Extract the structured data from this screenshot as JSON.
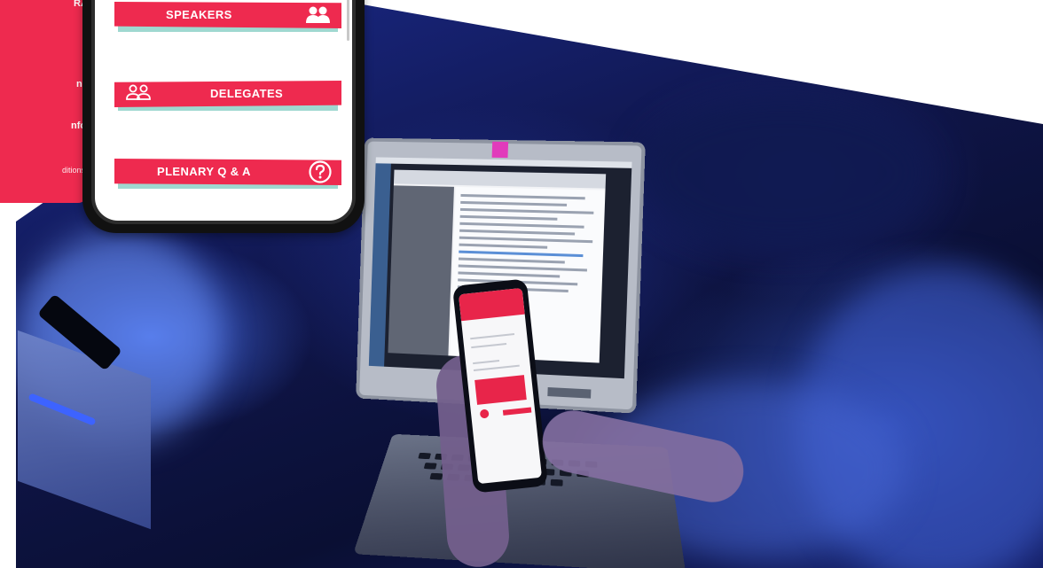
{
  "left_menu": {
    "items": [
      "RA",
      "ns",
      "nfo",
      "ditions"
    ]
  },
  "phone_menu": {
    "items": [
      {
        "label": "SPEAKERS",
        "icon": "speakers-icon"
      },
      {
        "label": "DELEGATES",
        "icon": "delegates-icon"
      },
      {
        "label": "PLENARY Q & A",
        "icon": "question-icon"
      }
    ]
  },
  "colors": {
    "brand_red": "#ee2a4f",
    "banner_shadow": "#9fd8d0",
    "photo_blue": "#1b2a8c"
  }
}
